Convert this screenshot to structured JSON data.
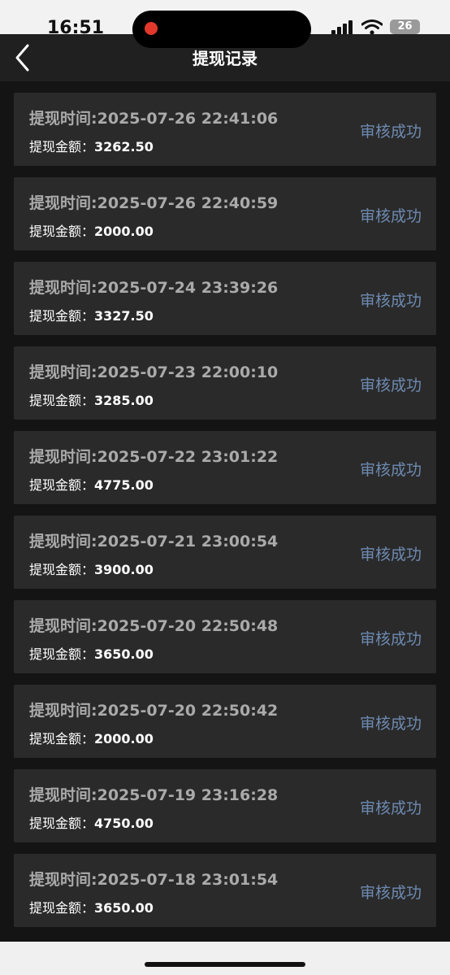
{
  "status_bar": {
    "time": "16:51",
    "battery": "26"
  },
  "nav": {
    "title": "提现记录"
  },
  "labels": {
    "time_prefix": "提现时间:",
    "amount_prefix": "提现金额："
  },
  "records": [
    {
      "time": "2025-07-26 22:41:06",
      "amount": "3262.50",
      "status": "审核成功"
    },
    {
      "time": "2025-07-26 22:40:59",
      "amount": "2000.00",
      "status": "审核成功"
    },
    {
      "time": "2025-07-24 23:39:26",
      "amount": "3327.50",
      "status": "审核成功"
    },
    {
      "time": "2025-07-23 22:00:10",
      "amount": "3285.00",
      "status": "审核成功"
    },
    {
      "time": "2025-07-22 23:01:22",
      "amount": "4775.00",
      "status": "审核成功"
    },
    {
      "time": "2025-07-21 23:00:54",
      "amount": "3900.00",
      "status": "审核成功"
    },
    {
      "time": "2025-07-20 22:50:48",
      "amount": "3650.00",
      "status": "审核成功"
    },
    {
      "time": "2025-07-20 22:50:42",
      "amount": "2000.00",
      "status": "审核成功"
    },
    {
      "time": "2025-07-19 23:16:28",
      "amount": "4750.00",
      "status": "审核成功"
    },
    {
      "time": "2025-07-18 23:01:54",
      "amount": "3650.00",
      "status": "审核成功"
    }
  ],
  "colors": {
    "status_text": "#6d8ab1",
    "card_bg": "#2a2a2a",
    "page_bg": "#141414"
  },
  "icons": {
    "back": "chevron-left-icon",
    "signal": "signal-icon",
    "wifi": "wifi-icon",
    "battery": "battery-icon"
  }
}
